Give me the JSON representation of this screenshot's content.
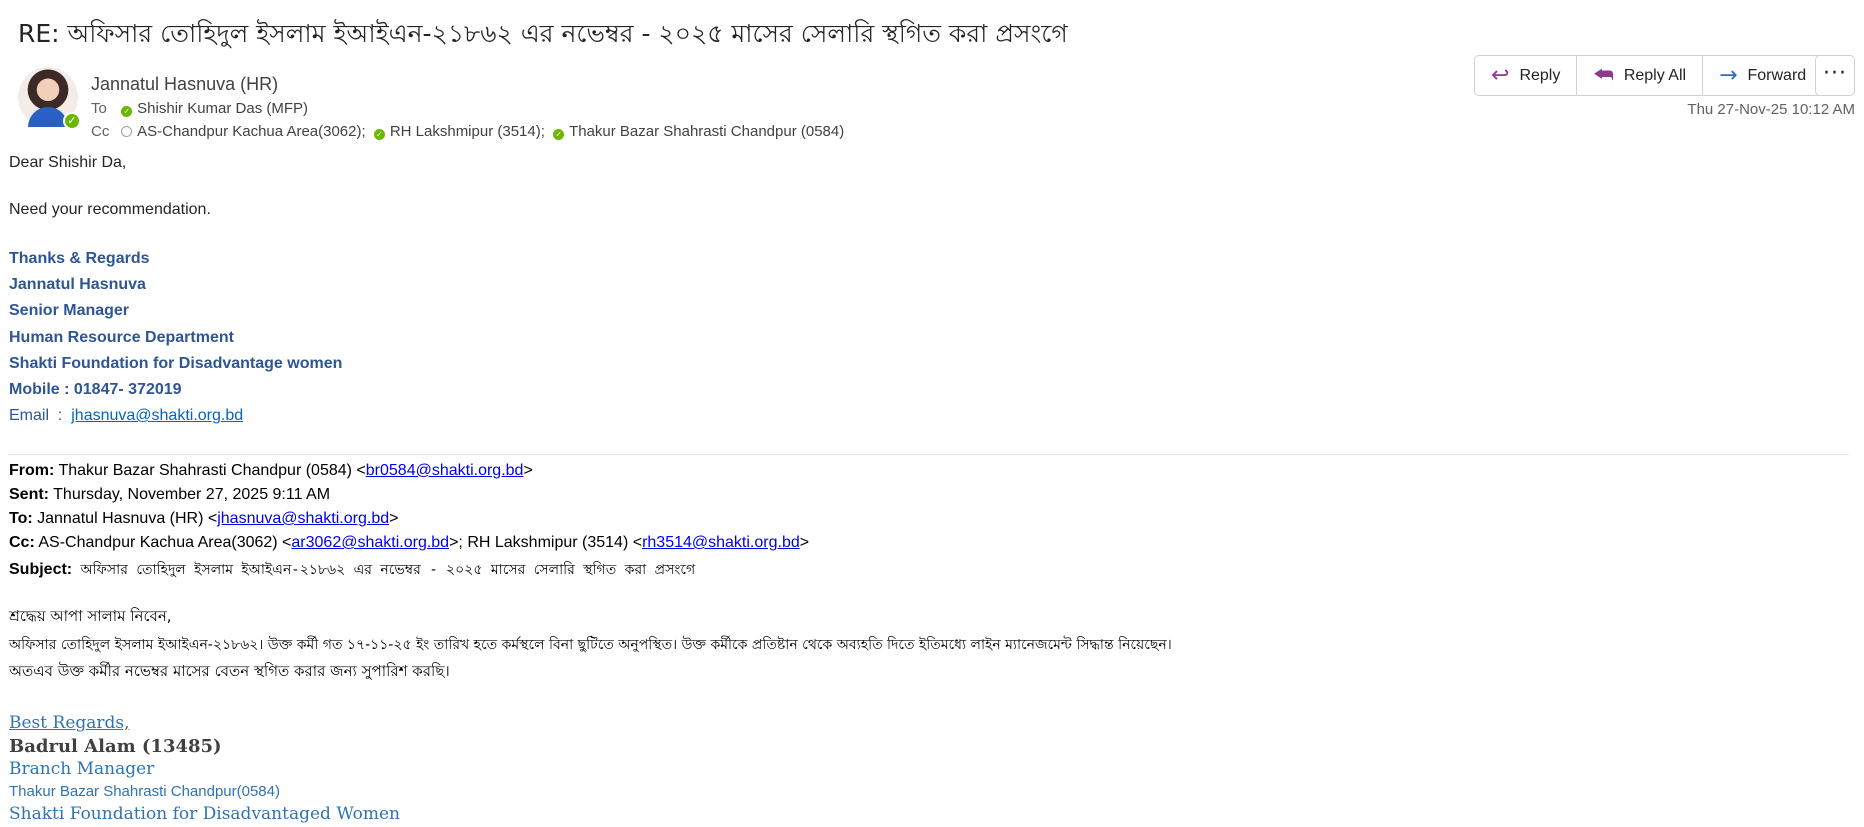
{
  "subject": "RE:  অফিসার তোহিদুল ইসলাম ইআইএন-২১৮৬২ এর নভেম্বর - ২০২৫ মাসের সেলারি স্থগিত  করা প্রসংগে",
  "sender": {
    "name": "Jannatul Hasnuva (HR)",
    "to_label": "To",
    "to": "Shishir Kumar Das (MFP)",
    "cc_label": "Cc",
    "cc": [
      "AS-Chandpur Kachua Area(3062);",
      "RH Lakshmipur (3514);",
      "Thakur Bazar Shahrasti Chandpur (0584)"
    ],
    "date": "Thu 27-Nov-25 10:12 AM"
  },
  "actions": {
    "reply": "Reply",
    "reply_all": "Reply All",
    "forward": "Forward",
    "more": "···"
  },
  "message": {
    "greeting": "Dear Shishir Da,",
    "line1": "Need your recommendation."
  },
  "signature": {
    "regards": "Thanks & Regards",
    "name": "Jannatul Hasnuva",
    "title": "Senior Manager",
    "dept": "Human Resource Department",
    "org": "Shakti Foundation for Disadvantage women",
    "mobile": "Mobile : 01847- 372019",
    "email_label": "Email  :  ",
    "email": "jhasnuva@shakti.org.bd"
  },
  "quoted": {
    "from_label": "From:",
    "from": " Thakur Bazar Shahrasti Chandpur (0584) <",
    "from_email": "br0584@shakti.org.bd",
    "sent_label": "Sent:",
    "sent": " Thursday, November 27, 2025 9:11 AM",
    "to_label": "To:",
    "to": " Jannatul Hasnuva (HR) <",
    "to_email": "jhasnuva@shakti.org.bd",
    "cc_label": "Cc:",
    "cc1": " AS-Chandpur Kachua Area(3062) <",
    "cc1_email": "ar3062@shakti.org.bd",
    "cc2": ">; RH Lakshmipur (3514) <",
    "cc2_email": "rh3514@shakti.org.bd",
    "subject_label": "Subject:",
    "subject": " অফিসার তোহিদুল ইসলাম ইআইএন-২১৮৬২ এর নভেম্বর - ২০২৫ মাসের সেলারি স্থগিত করা প্রসংগে",
    "close": ">",
    "body1": "শ্রদ্ধেয় আপা সালাম নিবেন,",
    "body2": "অফিসার তোহিদুল ইসলাম ইআইএন-২১৮৬২। উক্ত কর্মী গত ১৭-১১-২৫ ইং তারিখ হতে কর্মস্থলে বিনা ছুটিতে অনুপস্থিত। উক্ত কর্মীকে প্রতিষ্টান থেকে অব্যহতি দিতে ইতিমধ্যে লাইন ম্যানেজমেন্ট সিদ্ধান্ত নিয়েছেন।",
    "body3": "অতএব উক্ত কর্মীর নভেম্বর মাসের বেতন স্থগিত করার জন্য সুপারিশ করছি।",
    "sig_regards": "Best Regards,",
    "sig_name": "Badrul Alam (13485)",
    "sig_title": "Branch Manager",
    "sig_branch": "Thakur Bazar Shahrasti Chandpur(0584)",
    "sig_org": "Shakti Foundation for Disadvantaged Women"
  },
  "colors": {
    "signature_blue": "#2f5597",
    "link_blue": "#0563c1",
    "presence_green": "#6bb700",
    "reply_icon": "#8b3a8f",
    "forward_icon": "#2f6fbd"
  }
}
